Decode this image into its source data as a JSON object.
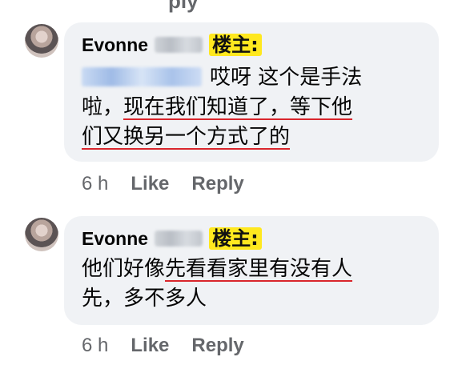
{
  "top_peek": "ply",
  "comments": [
    {
      "author": "Evonne",
      "badge": "楼主:",
      "line1_rest": "哎呀 这个是手法",
      "line2_a": "啦，",
      "line2_b": "现在我们知道了，等下他",
      "line3": "们又换另一个方式了的",
      "time": "6 h",
      "like": "Like",
      "reply": "Reply"
    },
    {
      "author": "Evonne",
      "badge": "楼主:",
      "line1_a": "他们好像",
      "line1_b": "先看看家里有没有人",
      "line2": "先，多不多人",
      "time": "6 h",
      "like": "Like",
      "reply": "Reply"
    }
  ]
}
